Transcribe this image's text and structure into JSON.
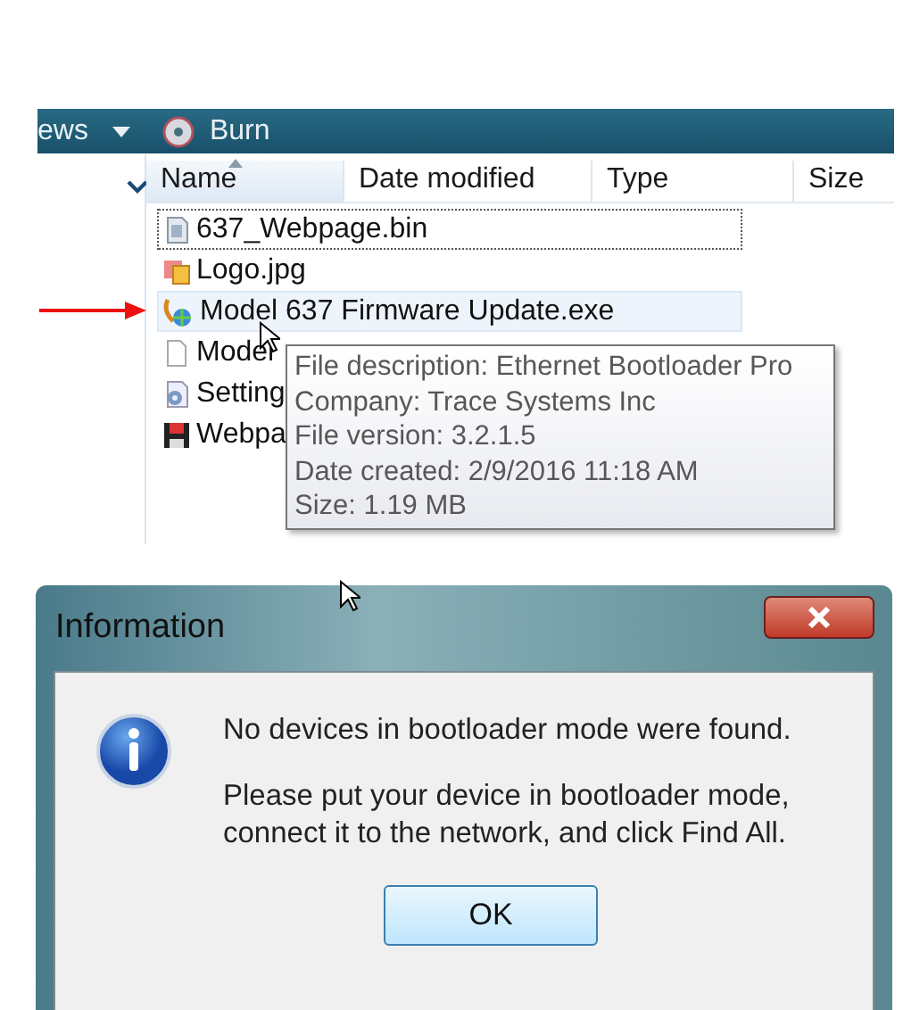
{
  "explorer": {
    "toolbar": [
      {
        "kind": "text",
        "label": "ews"
      },
      {
        "kind": "caret"
      },
      {
        "kind": "disc",
        "label": "Burn"
      }
    ],
    "columns": [
      {
        "label": "Name",
        "sorted": true
      },
      {
        "label": "Date modified",
        "sorted": false
      },
      {
        "label": "Type",
        "sorted": false
      },
      {
        "label": "Size",
        "sorted": false
      }
    ],
    "files": [
      {
        "kind": "bin",
        "name": "637_Webpage.bin",
        "focused": true,
        "hovered": false,
        "pointed": false
      },
      {
        "kind": "image",
        "name": "Logo.jpg",
        "focused": false,
        "hovered": false,
        "pointed": false
      },
      {
        "kind": "exe",
        "name": "Model 637 Firmware Update.exe",
        "focused": false,
        "hovered": true,
        "pointed": true
      },
      {
        "kind": "blank",
        "name": "Model",
        "focused": false,
        "hovered": false,
        "pointed": false
      },
      {
        "kind": "settings",
        "name": "Setting",
        "focused": false,
        "hovered": false,
        "pointed": false
      },
      {
        "kind": "disk",
        "name": "Webpa",
        "focused": false,
        "hovered": false,
        "pointed": false
      }
    ],
    "tooltip": [
      "File description: Ethernet Bootloader Pro",
      "Company: Trace Systems Inc",
      "File version: 3.2.1.5",
      "Date created: 2/9/2016 11:18 AM",
      "Size: 1.19 MB"
    ]
  },
  "dialog": {
    "title": "Information",
    "messages": [
      "No devices in bootloader mode were found.",
      "Please put your device in bootloader mode, connect it to the network, and click Find All."
    ],
    "button": "OK"
  }
}
